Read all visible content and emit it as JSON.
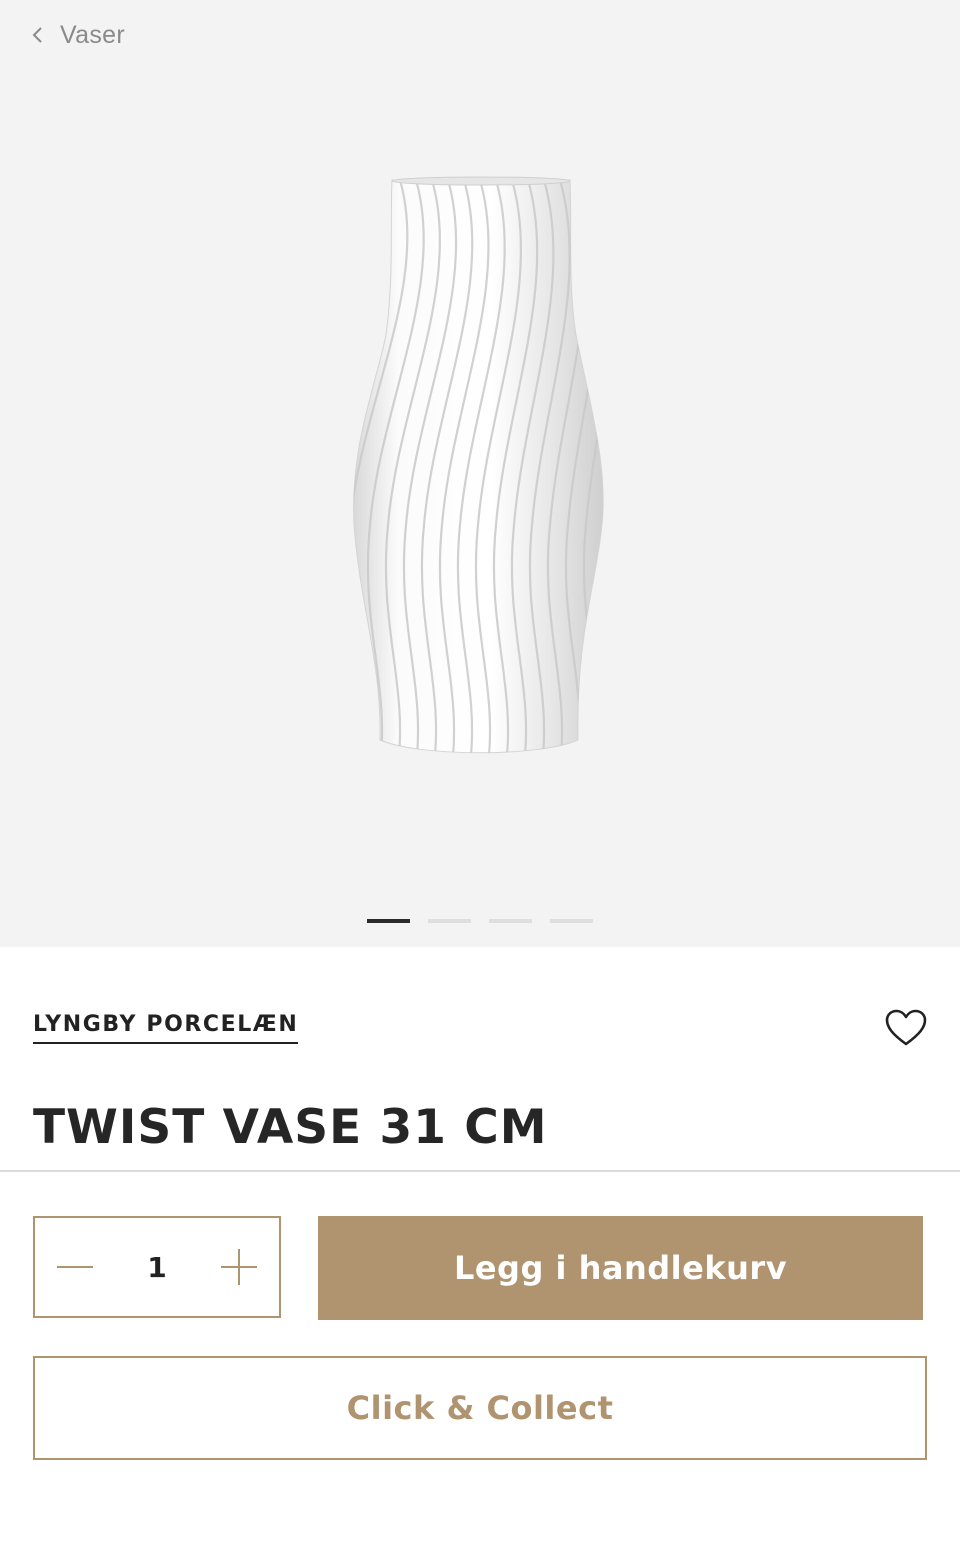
{
  "breadcrumb": {
    "back_label": "Vaser",
    "back_icon": "chevron-left-icon"
  },
  "gallery": {
    "image_alt_subject": "white twisted porcelain vase",
    "slide_count": 4,
    "active_slide": 1
  },
  "product": {
    "brand": "LYNGBY PORCELÆN",
    "title": "TWIST VASE 31 CM",
    "wishlist_icon": "heart-outline-icon"
  },
  "purchase": {
    "quantity": "1",
    "decrement_icon": "minus-icon",
    "increment_icon": "plus-icon",
    "add_to_cart_label": "Legg i handlekurv",
    "click_collect_label": "Click & Collect"
  },
  "colors": {
    "accent": "#b0936f",
    "gallery_bg": "#f3f3f3",
    "text": "#222222",
    "muted": "#8a8a8a"
  }
}
